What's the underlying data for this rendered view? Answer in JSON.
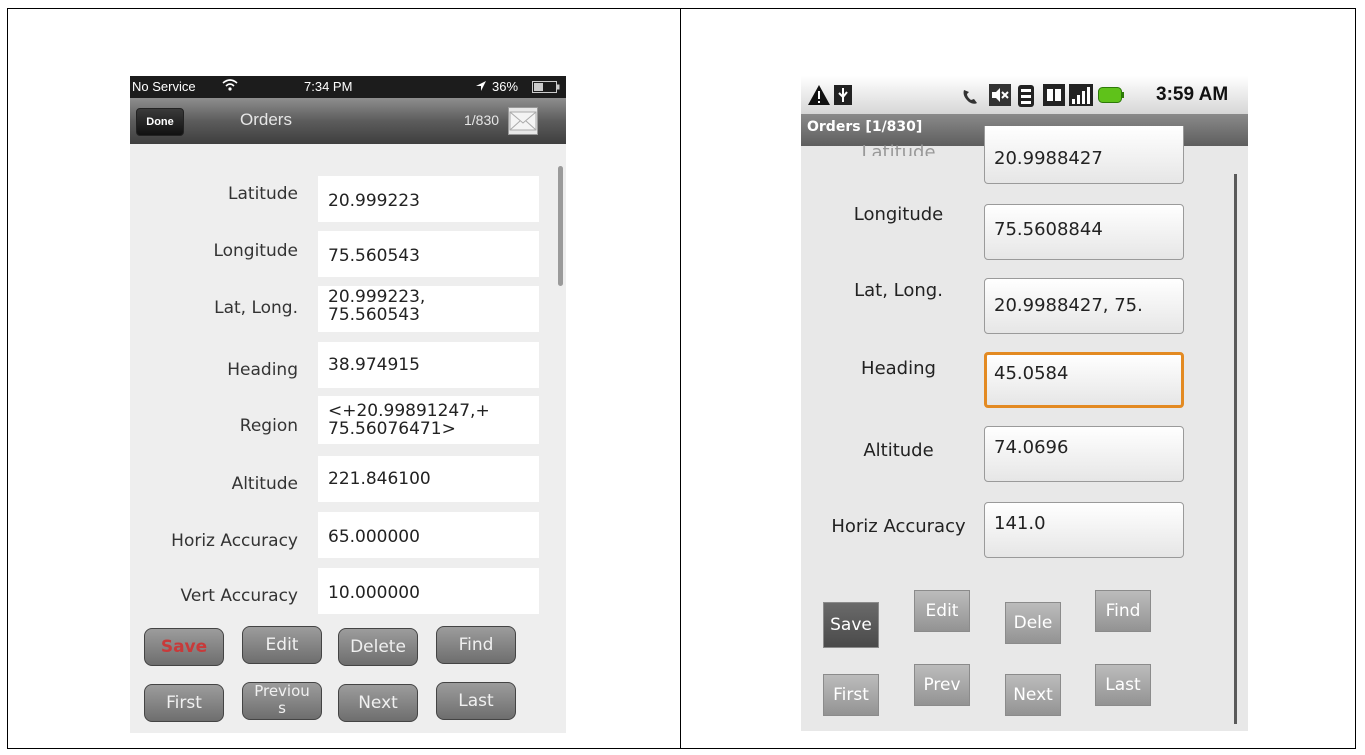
{
  "ios": {
    "status": {
      "carrier": "No Service",
      "time": "7:34 PM",
      "battery": "36%"
    },
    "nav": {
      "done_label": "Done",
      "title": "Orders",
      "record_count": "1/830",
      "mail_icon": "mail-icon"
    },
    "fields": [
      {
        "label": "Latitude",
        "value": "20.999223"
      },
      {
        "label": "Longitude",
        "value": "75.560543"
      },
      {
        "label": "Lat, Long.",
        "value": "20.999223,\n75.560543"
      },
      {
        "label": "Heading",
        "value": "38.974915"
      },
      {
        "label": "Region",
        "value": "<+20.99891247,+\n75.56076471>"
      },
      {
        "label": "Altitude",
        "value": "221.846100"
      },
      {
        "label": "Horiz Accuracy",
        "value": "65.000000"
      },
      {
        "label": "Vert Accuracy",
        "value": "10.000000"
      }
    ],
    "buttons": {
      "row1": [
        "Save",
        "Edit",
        "Delete",
        "Find"
      ],
      "row2": [
        "First",
        "Previou\ns",
        "Next",
        "Last"
      ]
    },
    "save_color": "#c83a3a"
  },
  "android": {
    "status": {
      "time": "3:59 AM"
    },
    "title": "Orders [1/830]",
    "fields": [
      {
        "label": "Latitude",
        "value": "20.9988427"
      },
      {
        "label": "Longitude",
        "value": "75.5608844"
      },
      {
        "label": "Lat, Long.",
        "value": "20.9988427, 75."
      },
      {
        "label": "Heading",
        "value": "45.0584"
      },
      {
        "label": "Altitude",
        "value": "74.0696"
      },
      {
        "label": "Horiz Accuracy",
        "value": "141.0"
      }
    ],
    "buttons": {
      "row1": [
        "Save",
        "Edit",
        "Dele",
        "Find"
      ],
      "row2": [
        "First",
        "Prev",
        "Next",
        "Last"
      ]
    },
    "focus_color": "#e38a22"
  }
}
